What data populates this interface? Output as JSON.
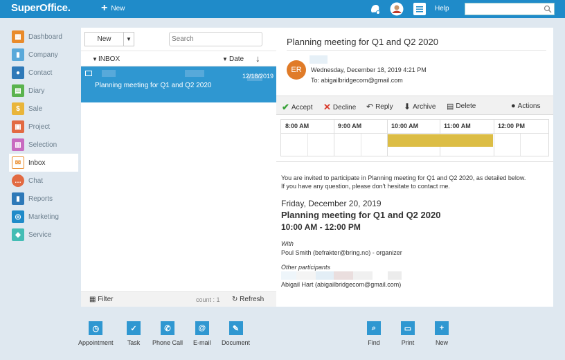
{
  "app": {
    "logo": "SuperOffice.",
    "new_label": "New",
    "help_label": "Help",
    "search_value": ""
  },
  "sidebar": {
    "items": [
      {
        "label": "Dashboard",
        "icon": "dashboard-icon",
        "color": "#e98b2b"
      },
      {
        "label": "Company",
        "icon": "company-icon",
        "color": "#5aa9da"
      },
      {
        "label": "Contact",
        "icon": "contact-icon",
        "color": "#2e79b8"
      },
      {
        "label": "Diary",
        "icon": "diary-icon",
        "color": "#5ab34e"
      },
      {
        "label": "Sale",
        "icon": "sale-icon",
        "color": "#e9b53a"
      },
      {
        "label": "Project",
        "icon": "project-icon",
        "color": "#e26a42"
      },
      {
        "label": "Selection",
        "icon": "selection-icon",
        "color": "#c86ac0"
      },
      {
        "label": "Inbox",
        "icon": "inbox-icon",
        "color": "#e98b2b"
      },
      {
        "label": "Chat",
        "icon": "chat-icon",
        "color": "#e26a42"
      },
      {
        "label": "Reports",
        "icon": "reports-icon",
        "color": "#2e79b8"
      },
      {
        "label": "Marketing",
        "icon": "marketing-icon",
        "color": "#1f8bc9"
      },
      {
        "label": "Service",
        "icon": "service-icon",
        "color": "#43bdb5"
      }
    ]
  },
  "inbox": {
    "new_label": "New",
    "search_placeholder": "Search",
    "folder_label": "INBOX",
    "sort_label": "Date",
    "message": {
      "date": "12/18/2019",
      "subject": "Planning meeting for Q1 and Q2 2020"
    },
    "filter_label": "Filter",
    "count_label": "count : 1",
    "refresh_label": "Refresh"
  },
  "pane": {
    "title": "Planning meeting for Q1 and Q2 2020",
    "avatar_initials": "ER",
    "sent": "Wednesday, December 18, 2019 4:21 PM",
    "to": "To: abigailbridgecom@gmail.com",
    "actions": {
      "accept": "Accept",
      "decline": "Decline",
      "reply": "Reply",
      "archive": "Archive",
      "delete": "Delete",
      "more": "Actions"
    },
    "calendar_hours": [
      "8:00 AM",
      "9:00 AM",
      "10:00 AM",
      "11:00 AM",
      "12:00 PM"
    ],
    "invite_line1": "You are invited to participate in Planning meeting for Q1 and Q2 2020, as detailed below.",
    "invite_line2": "If you have any question, please don't hesitate to contact me.",
    "meeting_date": "Friday, December 20, 2019",
    "meeting_title": "Planning meeting for Q1 and Q2 2020",
    "meeting_time": "10:00 AM - 12:00 PM",
    "with_label": "With",
    "organizer": "Poul Smith (befrakter@bring.no) - organizer",
    "others_label": "Other participants",
    "participant": "Abigail Hart (abigailbridgecom@gmail.com)"
  },
  "bottom": {
    "left": [
      {
        "label": "Appointment",
        "icon": "clock-icon"
      },
      {
        "label": "Task",
        "icon": "check-icon"
      },
      {
        "label": "Phone Call",
        "icon": "phone-icon"
      },
      {
        "label": "E-mail",
        "icon": "at-icon"
      },
      {
        "label": "Document",
        "icon": "pen-icon"
      }
    ],
    "right": [
      {
        "label": "Find",
        "icon": "search-icon"
      },
      {
        "label": "Print",
        "icon": "print-icon"
      },
      {
        "label": "New",
        "icon": "plus-icon"
      }
    ]
  }
}
